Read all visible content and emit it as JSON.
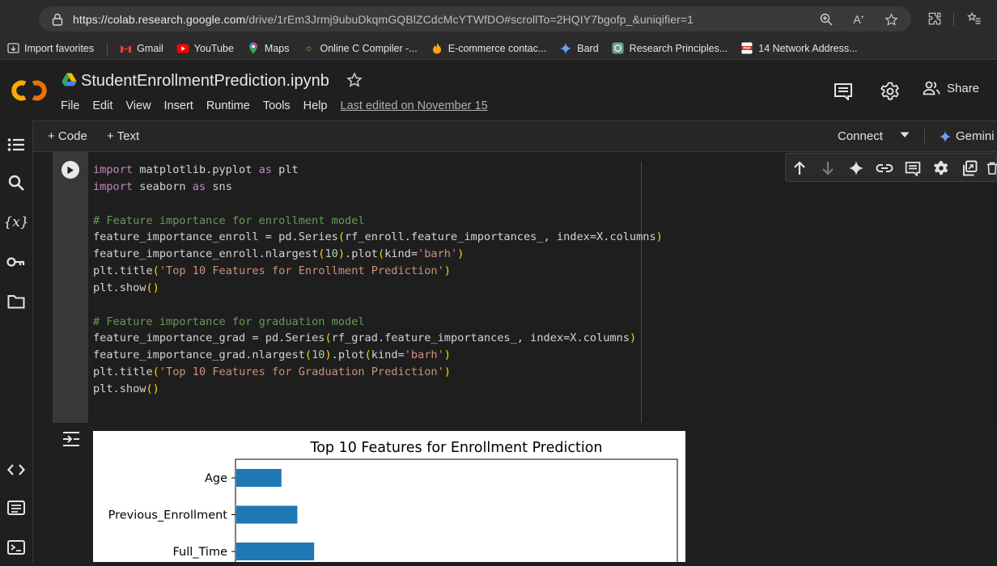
{
  "browser": {
    "url_host": "https://colab.research.google.com",
    "url_path": "/drive/1rEm3Jrmj9ubuDkqmGQBlZCdcMcYTWfDO#scrollTo=2HQIY7bgofp_&uniqifier=1",
    "bookmarks": [
      {
        "label": "Import favorites",
        "icon": "import-icon"
      },
      {
        "label": "Gmail",
        "icon": "gmail-icon"
      },
      {
        "label": "YouTube",
        "icon": "youtube-icon"
      },
      {
        "label": "Maps",
        "icon": "maps-icon"
      },
      {
        "label": "Online C Compiler -...",
        "icon": "compiler-icon"
      },
      {
        "label": "E-commerce contac...",
        "icon": "flame-icon"
      },
      {
        "label": "Bard",
        "icon": "bard-icon"
      },
      {
        "label": "Research Principles...",
        "icon": "chatgpt-icon"
      },
      {
        "label": "14 Network Address...",
        "icon": "pdf-icon"
      }
    ]
  },
  "colab": {
    "notebook_title": "StudentEnrollmentPrediction.ipynb",
    "menu": [
      "File",
      "Edit",
      "View",
      "Insert",
      "Runtime",
      "Tools",
      "Help"
    ],
    "last_edited": "Last edited on November 15",
    "share_label": "Share",
    "toolbar": {
      "add_code": "+ Code",
      "add_text": "+ Text",
      "connect": "Connect",
      "gemini": "Gemini"
    }
  },
  "code_cell": {
    "lines": [
      "import matplotlib.pyplot as plt",
      "import seaborn as sns",
      "",
      "# Feature importance for enrollment model",
      "feature_importance_enroll = pd.Series(rf_enroll.feature_importances_, index=X.columns)",
      "feature_importance_enroll.nlargest(10).plot(kind='barh')",
      "plt.title('Top 10 Features for Enrollment Prediction')",
      "plt.show()",
      "",
      "# Feature importance for graduation model",
      "feature_importance_grad = pd.Series(rf_grad.feature_importances_, index=X.columns)",
      "feature_importance_grad.nlargest(10).plot(kind='barh')",
      "plt.title('Top 10 Features for Graduation Prediction')",
      "plt.show()"
    ]
  },
  "chart_data": {
    "type": "bar",
    "orientation": "horizontal",
    "title": "Top 10 Features for Enrollment Prediction",
    "categories": [
      "Age",
      "Previous_Enrollment",
      "Full_Time"
    ],
    "values": [
      0.104,
      0.14,
      0.178
    ],
    "xlim": [
      0,
      1.0
    ],
    "color": "#1f77b4"
  }
}
